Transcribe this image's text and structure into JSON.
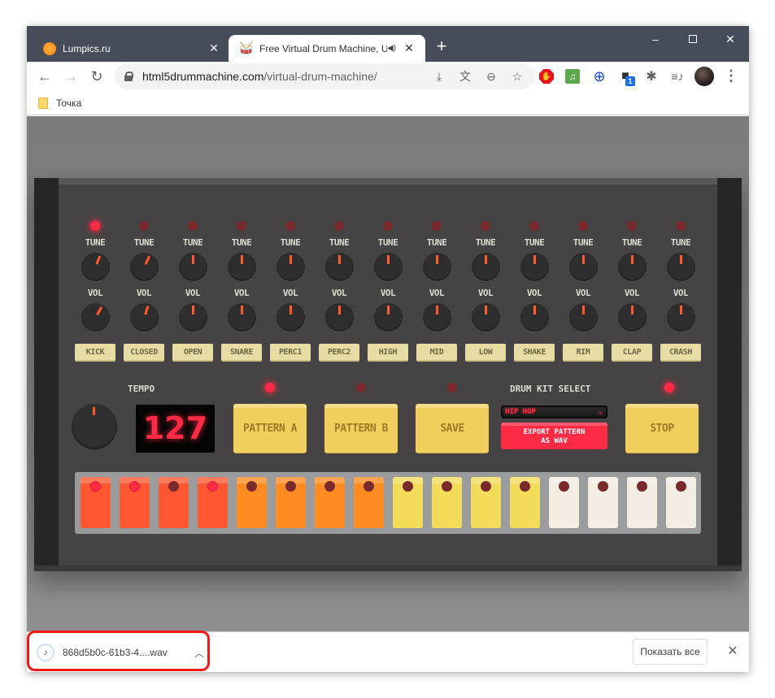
{
  "browser": {
    "tabs": [
      {
        "title": "Lumpics.ru",
        "active": false,
        "favicon": "orange-icon"
      },
      {
        "title": "Free Virtual Drum Machine, U",
        "active": true,
        "favicon": "drum-kit-icon",
        "audio": true
      }
    ],
    "new_tab": "+",
    "window_controls": {
      "minimize": "–",
      "maximize": "",
      "close": "✕"
    },
    "url_host": "html5drummachine.com",
    "url_path": "/virtual-drum-machine/",
    "omnibox_icons": [
      "download-icon",
      "translate-icon",
      "zoom-out-icon",
      "star-icon"
    ],
    "extensions": [
      {
        "name": "adblock-icon",
        "glyph": "✋"
      },
      {
        "name": "music-extension-icon",
        "glyph": "♫"
      },
      {
        "name": "globe-extension-icon",
        "glyph": "🌐"
      },
      {
        "name": "box-extension-icon",
        "glyph": "■",
        "badge": "1"
      },
      {
        "name": "puzzle-icon",
        "glyph": "✱"
      },
      {
        "name": "media-control-icon",
        "glyph": "≡♪"
      }
    ],
    "menu": "⋮",
    "bookmarks": [
      {
        "label": "Точка"
      }
    ]
  },
  "drum_machine": {
    "channels": [
      {
        "name": "KICK",
        "led_on": true,
        "tune": 0.12,
        "vol": 0.17
      },
      {
        "name": "CLOSED",
        "led_on": false,
        "tune": 0.14,
        "vol": 0.1
      },
      {
        "name": "OPEN",
        "led_on": false,
        "tune": 0,
        "vol": 0
      },
      {
        "name": "SNARE",
        "led_on": false,
        "tune": 0,
        "vol": 0
      },
      {
        "name": "PERC1",
        "led_on": false,
        "tune": 0,
        "vol": 0
      },
      {
        "name": "PERC2",
        "led_on": false,
        "tune": 0,
        "vol": 0
      },
      {
        "name": "HIGH",
        "led_on": false,
        "tune": 0,
        "vol": 0
      },
      {
        "name": "MID",
        "led_on": false,
        "tune": 0,
        "vol": 0
      },
      {
        "name": "LOW",
        "led_on": false,
        "tune": 0,
        "vol": 0
      },
      {
        "name": "SHAKE",
        "led_on": false,
        "tune": 0,
        "vol": 0
      },
      {
        "name": "RIM",
        "led_on": false,
        "tune": 0,
        "vol": 0
      },
      {
        "name": "CLAP",
        "led_on": false,
        "tune": 0,
        "vol": 0
      },
      {
        "name": "CRASH",
        "led_on": false,
        "tune": 0,
        "vol": 0
      }
    ],
    "tune_label": "TUNE",
    "vol_label": "VOL",
    "tempo_label": "TEMPO",
    "tempo_value": "127",
    "pattern_a": {
      "label": "PATTERN A",
      "led_on": true
    },
    "pattern_b": {
      "label": "PATTERN B",
      "led_on": false
    },
    "save": {
      "label": "SAVE",
      "led_on": false
    },
    "stop": {
      "label": "STOP",
      "led_on": true
    },
    "kit_select_label": "DRUM KIT SELECT",
    "kit_selected": "HIP HOP",
    "export_label_1": "EXPORT PATTERN",
    "export_label_2": "AS WAV",
    "steps": [
      {
        "color": "#ff5731",
        "on": true
      },
      {
        "color": "#ff5731",
        "on": true
      },
      {
        "color": "#ff5731",
        "on": false
      },
      {
        "color": "#ff5731",
        "on": true
      },
      {
        "color": "#ff8c22",
        "on": false
      },
      {
        "color": "#ff8c22",
        "on": false
      },
      {
        "color": "#ff8c22",
        "on": false
      },
      {
        "color": "#ff8c22",
        "on": false
      },
      {
        "color": "#f2dc5a",
        "on": false
      },
      {
        "color": "#f2dc5a",
        "on": false
      },
      {
        "color": "#f2dc5a",
        "on": false
      },
      {
        "color": "#f2dc5a",
        "on": false
      },
      {
        "color": "#f3ede3",
        "on": false
      },
      {
        "color": "#f3ede3",
        "on": false
      },
      {
        "color": "#f3ede3",
        "on": false
      },
      {
        "color": "#f3ede3",
        "on": false
      }
    ]
  },
  "downloads": {
    "file_name": "868d5b0c-61b3-4....wav",
    "show_all": "Показать все",
    "close": "✕"
  }
}
